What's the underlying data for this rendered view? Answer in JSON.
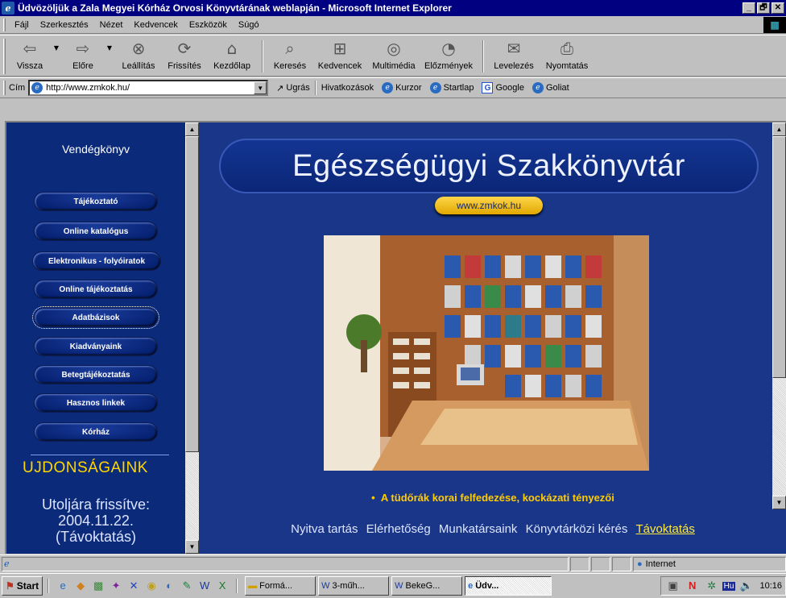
{
  "window": {
    "title": "Üdvözöljük a Zala Megyei Kórház Orvosi Könyvtárának weblapján - Microsoft Internet Explorer",
    "minimize": "_",
    "maximize": "🗗",
    "close": "✕"
  },
  "menu": [
    "Fájl",
    "Szerkesztés",
    "Nézet",
    "Kedvencek",
    "Eszközök",
    "Súgó"
  ],
  "toolbar": {
    "back": "Vissza",
    "forward": "Előre",
    "stop": "Leállítás",
    "refresh": "Frissítés",
    "home": "Kezdőlap",
    "search": "Keresés",
    "favorites": "Kedvencek",
    "media": "Multimédia",
    "history": "Előzmények",
    "mail": "Levelezés",
    "print": "Nyomtatás"
  },
  "address": {
    "label": "Cím",
    "url": "http://www.zmkok.hu/",
    "go": "Ugrás",
    "links_label": "Hivatkozások",
    "links": [
      "Kurzor",
      "Startlap",
      "Google",
      "Goliat"
    ]
  },
  "sidebar": {
    "guestbook": "Vendégkönyv",
    "items": [
      "Tájékoztató",
      "Online katalógus",
      "Elektronikus - folyóiratok",
      "Online tájékoztatás",
      "Adatbázisok",
      "Kiadványaink",
      "Betegtájékoztatás",
      "Hasznos linkek",
      "Kórház"
    ],
    "news": "UJDONSÁGAINK",
    "updated_line1": "Utoljára frissítve:",
    "updated_line2": "2004.11.22.",
    "updated_line3": "(Távoktatás)"
  },
  "main": {
    "banner": "Egészségügyi Szakkönyvtár",
    "site": "www.zmkok.hu",
    "bullet": "A tüdőrák korai felfedezése, kockázati tényezői",
    "footer_links": [
      "Nyitva tartás",
      "Elérhetőség",
      "Munkatársaink",
      "Könyvtárközi kérés",
      "Távoktatás"
    ]
  },
  "status": {
    "zone": "Internet"
  },
  "taskbar": {
    "start": "Start",
    "tasks": [
      "Formá...",
      "3-műh...",
      "BekeG...",
      "Üdv..."
    ],
    "lang": "Hu",
    "clock": "10:16"
  }
}
